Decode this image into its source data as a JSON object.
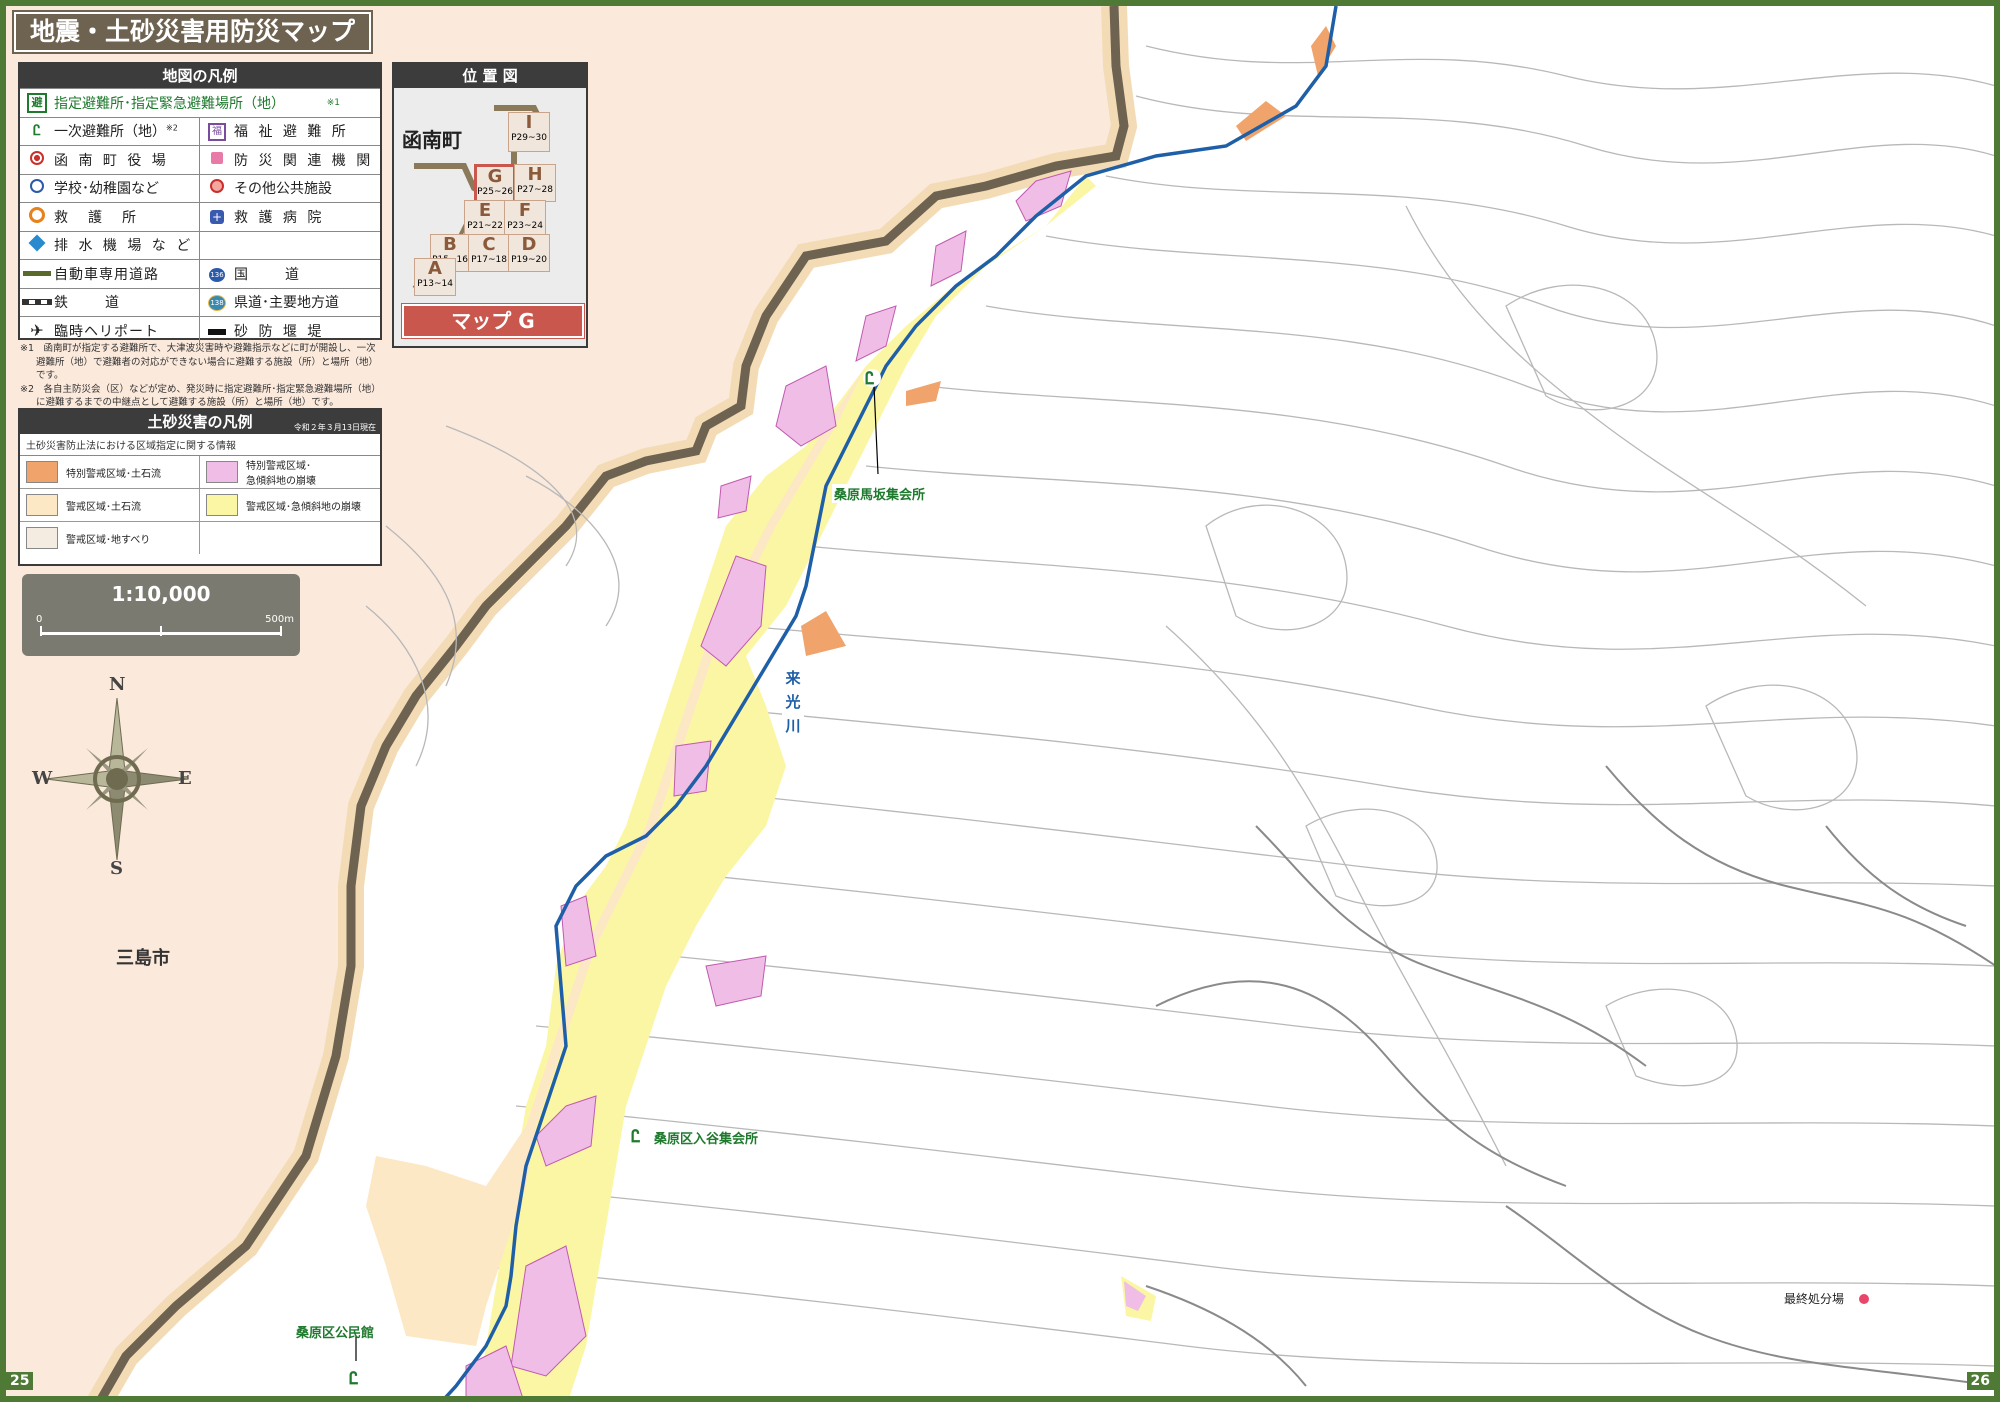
{
  "title": "地震・土砂災害用防災マップ",
  "legend": {
    "header": "地図の凡例",
    "full_row": "指定避難所･指定緊急避難場所（地）",
    "full_row_note": "※1",
    "rows": [
      {
        "left": "一次避難所（地）",
        "left_note": "※2",
        "right": "福 祉 避 難 所"
      },
      {
        "left": "函 南 町 役 場",
        "right": "防 災 関 連 機 関"
      },
      {
        "left": "学校･幼稚園など",
        "right": "その他公共施設"
      },
      {
        "left": "救　護　所",
        "right": "救 護 病 院"
      },
      {
        "left": "排 水 機 場 な ど",
        "right": ""
      },
      {
        "left": "自動車専用道路",
        "right": "国　　道"
      },
      {
        "left": "鉄　　道",
        "right": "県道･主要地方道"
      },
      {
        "left": "臨時ヘリポート",
        "right": "砂 防 堰 堤"
      }
    ],
    "route_numbers": {
      "national": "136",
      "prefectural": "138"
    },
    "footnotes": [
      "※1　函南町が指定する避難所で、大津波災害時や避難指示などに町が開設し、一次",
      "避難所（地）で避難者の対応ができない場合に避難する施設（所）と場所（地）です。",
      "※2　各自主防災会（区）などが定め、発災時に指定避難所･指定緊急避難場所（地）",
      "に避難するまでの中継点として避難する施設（所）と場所（地）です。"
    ]
  },
  "sediment_legend": {
    "header": "土砂災害の凡例",
    "date": "令和２年３月13日現在",
    "subtitle": "土砂災害防止法における区域指定に関する情報",
    "items": [
      {
        "label": "特別警戒区域･土石流",
        "color": "#f0a36a"
      },
      {
        "label": "特別警戒区域･\n急傾斜地の崩壊",
        "color": "#f0bde6"
      },
      {
        "label": "警戒区域･土石流",
        "color": "#fde8c5"
      },
      {
        "label": "警戒区域･急傾斜地の崩壊",
        "color": "#fbf6a4"
      },
      {
        "label": "警戒区域･地すべり",
        "color": "#f4ece0"
      }
    ]
  },
  "scale": {
    "ratio": "1:10,000",
    "start": "0",
    "end": "500m"
  },
  "compass": {
    "n": "N",
    "s": "S",
    "e": "E",
    "w": "W"
  },
  "locator": {
    "header": "位 置 図",
    "town": "函南町",
    "map_name": "マップ G",
    "cells": [
      {
        "letter": "I",
        "pages": "P29~30"
      },
      {
        "letter": "G",
        "pages": "P25~26"
      },
      {
        "letter": "H",
        "pages": "P27~28"
      },
      {
        "letter": "E",
        "pages": "P21~22"
      },
      {
        "letter": "F",
        "pages": "P23~24"
      },
      {
        "letter": "B",
        "pages": "P15~16"
      },
      {
        "letter": "C",
        "pages": "P17~18"
      },
      {
        "letter": "D",
        "pages": "P19~20"
      },
      {
        "letter": "A",
        "pages": "P13~14"
      }
    ]
  },
  "map_labels": {
    "city": "三島市",
    "river": [
      "来",
      "光",
      "川"
    ],
    "shelter1": "桑原馬坂集会所",
    "shelter2": "桑原区入谷集会所",
    "shelter3": "桑原区公民館",
    "facility": "最終処分場"
  },
  "colors": {
    "frame": "#4f7a36",
    "neighbor_area": "#fbe9dc",
    "border_band": "#6e6251",
    "river": "#1f5fa8",
    "contour": "#b8b8b8",
    "shelter_green": "#1f7a2e"
  },
  "pages": {
    "left": "25",
    "right": "26"
  }
}
